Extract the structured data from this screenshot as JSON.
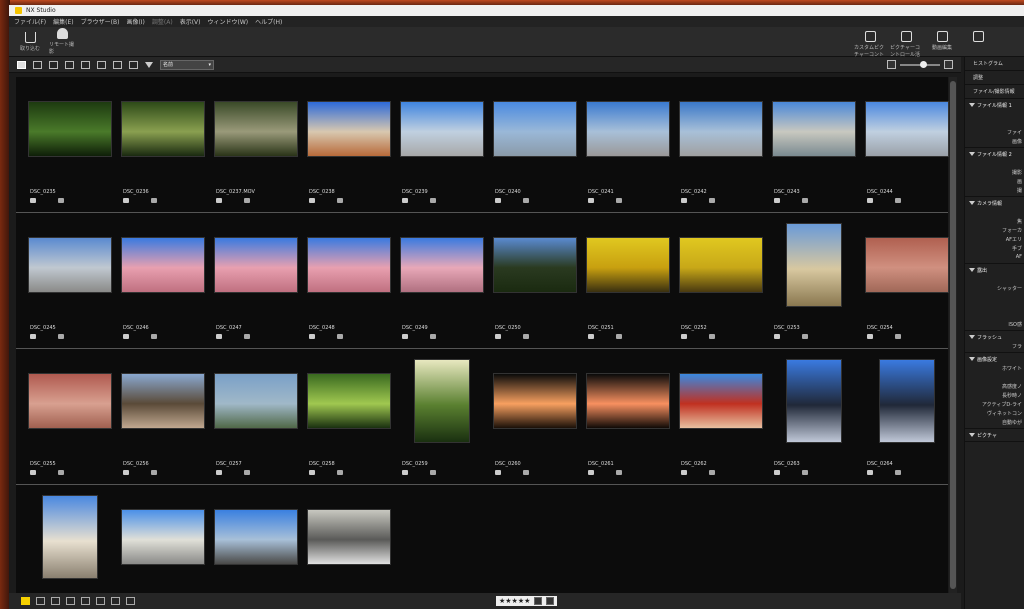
{
  "window": {
    "title": "NX Studio"
  },
  "menu": [
    "ファイル(F)",
    "編集(E)",
    "ブラウザー(B)",
    "画像(I)",
    "調整(A)",
    "表示(V)",
    "ウィンドウ(W)",
    "ヘルプ(H)"
  ],
  "toolbar": {
    "import_label": "取り込む",
    "remote_label": "リモート撮影",
    "right_tools": [
      "カスタムピクチャーコントロール",
      "ピクチャーコントロール活用",
      "動画編集",
      ""
    ]
  },
  "subbar": {
    "sort_label": "名前"
  },
  "rows": [
    {
      "items": [
        {
          "name": "DSC_0235",
          "colors": [
            "#1d3a10",
            "#4a7a2a",
            "#0e1e08"
          ],
          "portrait": false
        },
        {
          "name": "DSC_0236",
          "colors": [
            "#2d4a18",
            "#8aa050",
            "#1a2a10"
          ],
          "portrait": false
        },
        {
          "name": "DSC_0237.MOV",
          "colors": [
            "#3a4a28",
            "#9a9a7a",
            "#2a3418"
          ],
          "portrait": false
        },
        {
          "name": "DSC_0238",
          "colors": [
            "#2d6ad8",
            "#d8c8b0",
            "#b86a3a"
          ],
          "portrait": false
        },
        {
          "name": "DSC_0239",
          "colors": [
            "#3f85e0",
            "#c0d0e0",
            "#a8a8a8"
          ],
          "portrait": false
        },
        {
          "name": "DSC_0240",
          "colors": [
            "#4a8ae0",
            "#9ab8d8",
            "#8a9aa8"
          ],
          "portrait": false
        },
        {
          "name": "DSC_0241",
          "colors": [
            "#3a7ad0",
            "#a8c0d8",
            "#9a9898"
          ],
          "portrait": false
        },
        {
          "name": "DSC_0242",
          "colors": [
            "#3a78c8",
            "#a8c0d8",
            "#a0a0a0"
          ],
          "portrait": false
        },
        {
          "name": "DSC_0243",
          "colors": [
            "#4a88d8",
            "#c8c8c0",
            "#7a8a90"
          ],
          "portrait": false
        },
        {
          "name": "DSC_0244",
          "colors": [
            "#4a88e0",
            "#c0d0e0",
            "#9aa0a8"
          ],
          "portrait": false
        }
      ]
    },
    {
      "items": [
        {
          "name": "DSC_0245",
          "colors": [
            "#5a8ad0",
            "#c0c8d0",
            "#8a8a88"
          ],
          "portrait": false
        },
        {
          "name": "DSC_0246",
          "colors": [
            "#3a7ae0",
            "#e8a0b0",
            "#c07080"
          ],
          "portrait": false
        },
        {
          "name": "DSC_0247",
          "colors": [
            "#3a7ae0",
            "#e8a0b0",
            "#c07080"
          ],
          "portrait": false
        },
        {
          "name": "DSC_0248",
          "colors": [
            "#3a7ae0",
            "#e8a0b0",
            "#c07080"
          ],
          "portrait": false
        },
        {
          "name": "DSC_0249",
          "colors": [
            "#3a7ae0",
            "#e8a8b8",
            "#b07080"
          ],
          "portrait": false
        },
        {
          "name": "DSC_0250",
          "colors": [
            "#5a8ad0",
            "#2a3a20",
            "#1a2a10"
          ],
          "portrait": false
        },
        {
          "name": "DSC_0251",
          "colors": [
            "#e0c820",
            "#c8a010",
            "#3a3010"
          ],
          "portrait": false
        },
        {
          "name": "DSC_0252",
          "colors": [
            "#e0c820",
            "#c8a818",
            "#4a3a10"
          ],
          "portrait": false
        },
        {
          "name": "DSC_0253",
          "colors": [
            "#6a9ad8",
            "#d8c8a0",
            "#8a7850"
          ],
          "portrait": true
        },
        {
          "name": "DSC_0254",
          "colors": [
            "#b06050",
            "#d09080",
            "#a06858"
          ],
          "portrait": false
        }
      ]
    },
    {
      "items": [
        {
          "name": "DSC_0255",
          "colors": [
            "#b05a50",
            "#d8a090",
            "#a06050"
          ],
          "portrait": false
        },
        {
          "name": "DSC_0256",
          "colors": [
            "#8aa8d0",
            "#5a4a38",
            "#c0a890"
          ],
          "portrait": false
        },
        {
          "name": "DSC_0257",
          "colors": [
            "#7aa0c8",
            "#a0b8c8",
            "#506848"
          ],
          "portrait": false
        },
        {
          "name": "DSC_0258",
          "colors": [
            "#3a6a20",
            "#a0c850",
            "#1a3010"
          ],
          "portrait": false
        },
        {
          "name": "DSC_0259",
          "colors": [
            "#e8e8c0",
            "#5a8030",
            "#1a3010"
          ],
          "portrait": true
        },
        {
          "name": "DSC_0260",
          "colors": [
            "#0a0a0a",
            "#f8a060",
            "#1a1008"
          ],
          "portrait": false
        },
        {
          "name": "DSC_0261",
          "colors": [
            "#0a0a0a",
            "#f89060",
            "#100a06"
          ],
          "portrait": false
        },
        {
          "name": "DSC_0262",
          "colors": [
            "#3a88e0",
            "#c03020",
            "#e8c0a0"
          ],
          "portrait": false
        },
        {
          "name": "DSC_0263",
          "colors": [
            "#3a7ae0",
            "#202838",
            "#c0c8d8"
          ],
          "portrait": true
        },
        {
          "name": "DSC_0264",
          "colors": [
            "#3a7ae0",
            "#202838",
            "#c0c8d8"
          ],
          "portrait": true
        }
      ]
    },
    {
      "items": [
        {
          "name": "",
          "colors": [
            "#4a88e0",
            "#e8e0d0",
            "#8a8070"
          ],
          "portrait": true
        },
        {
          "name": "",
          "colors": [
            "#4a90e8",
            "#e0e0d8",
            "#8a8a88"
          ],
          "portrait": false
        },
        {
          "name": "",
          "colors": [
            "#3a80e0",
            "#a8c0d8",
            "#4a4a48"
          ],
          "portrait": false
        },
        {
          "name": "",
          "colors": [
            "#c8c8c0",
            "#5a5a58",
            "#e0e0e0"
          ],
          "portrait": false
        }
      ]
    }
  ],
  "panel": {
    "histogram": "ヒストグラム",
    "adjust": "調整",
    "info_tab": "ファイル/撮影情報",
    "sections": [
      {
        "title": "ファイル情報 1",
        "rows": [
          "",
          "",
          "ファイ",
          "画像"
        ]
      },
      {
        "title": "ファイル情報 2",
        "rows": [
          "",
          "撮影",
          "画",
          "撮"
        ]
      },
      {
        "title": "カメラ情報",
        "rows": [
          "",
          "焦",
          "フォーカ",
          "AFエリ",
          "手ブ",
          "AF"
        ]
      },
      {
        "title": "露出",
        "rows": [
          "",
          "シャッター",
          "",
          "",
          "",
          "ISO感"
        ]
      },
      {
        "title": "フラッシュ",
        "rows": [
          "フラ"
        ]
      },
      {
        "title": "画像設定",
        "rows": [
          "ホワイト",
          "",
          "高感度ノ",
          "長秒時ノ",
          "アクティブD-ライ",
          "ヴィネットコン",
          "自動ゆが"
        ]
      },
      {
        "title": "ピクチャ",
        "rows": []
      }
    ]
  },
  "bottom": {
    "stars": "★★★★★"
  }
}
